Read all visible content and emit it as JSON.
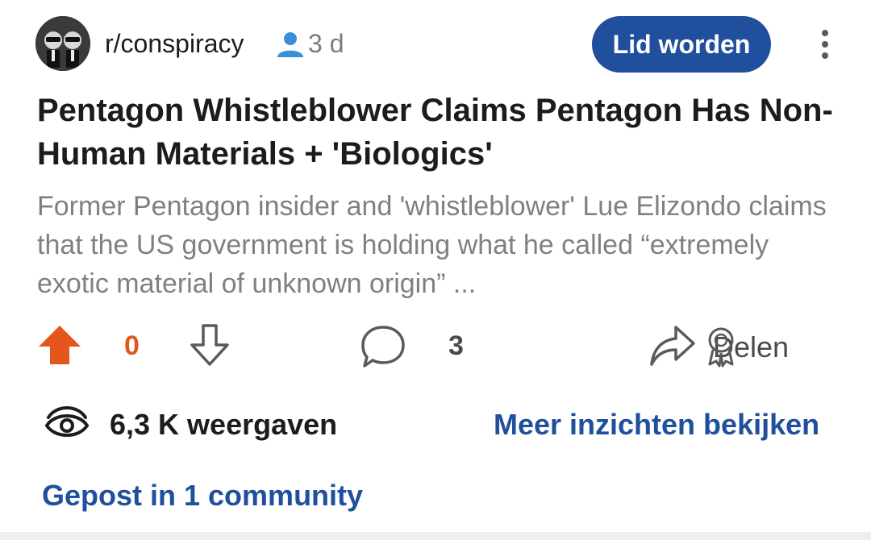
{
  "post": {
    "subreddit": "r/conspiracy",
    "age": "3 d",
    "join_label": "Lid worden",
    "title": "Pentagon Whistleblower Claims Pentagon Has Non-Human Materials + 'Biologics'",
    "body": "Former Pentagon insider and 'whistleblower' Lue Elizondo claims that the US government is holding what he called “extremely exotic material of unknown origin” ..."
  },
  "actions": {
    "vote_count": "0",
    "comment_count": "3",
    "share_label": "Delen"
  },
  "stats": {
    "views": "6,3 K weergaven",
    "insights_link": "Meer inzichten bekijken"
  },
  "community": {
    "label": "Gepost in 1 community"
  },
  "icons": {
    "avatar": "subreddit-avatar",
    "user": "user-icon",
    "more": "kebab-menu-icon",
    "upvote": "upvote-arrow-icon",
    "downvote": "downvote-arrow-icon",
    "comment": "comment-bubble-icon",
    "share": "share-arrow-icon",
    "award": "award-icon",
    "views": "eye-icon"
  },
  "colors": {
    "accent_blue": "#1f4f9d",
    "upvote_orange": "#e5561d",
    "title_text": "#1c1c1c",
    "body_text": "#808080"
  }
}
